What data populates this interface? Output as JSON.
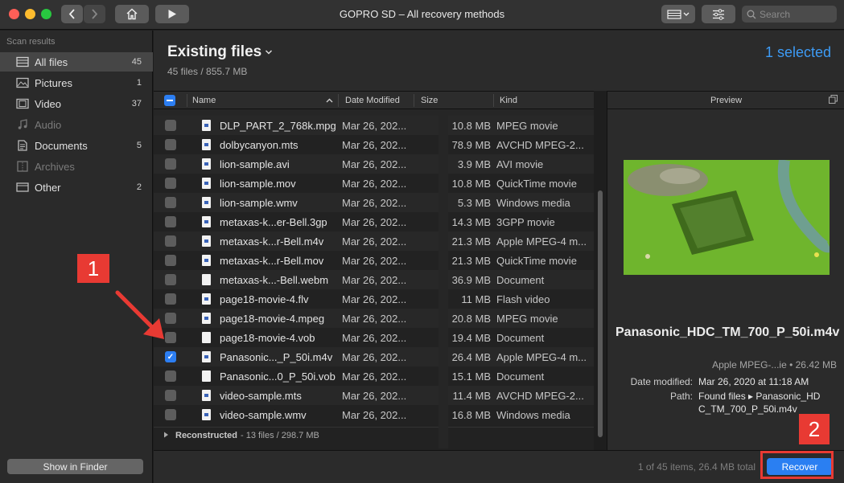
{
  "window": {
    "title": "GOPRO SD – All recovery methods"
  },
  "toolbar": {
    "search_placeholder": "Search"
  },
  "sidebar": {
    "heading": "Scan results",
    "items": [
      {
        "label": "All files",
        "count": "45",
        "icon": "stack-icon",
        "active": true
      },
      {
        "label": "Pictures",
        "count": "1",
        "icon": "picture-icon"
      },
      {
        "label": "Video",
        "count": "37",
        "icon": "film-icon"
      },
      {
        "label": "Audio",
        "count": "",
        "icon": "music-note-icon",
        "dim": true
      },
      {
        "label": "Documents",
        "count": "5",
        "icon": "document-icon"
      },
      {
        "label": "Archives",
        "count": "",
        "icon": "archive-icon",
        "dim": true
      },
      {
        "label": "Other",
        "count": "2",
        "icon": "other-icon"
      }
    ],
    "finder_button": "Show in Finder"
  },
  "main": {
    "title": "Existing files",
    "subtitle": "45 files / 855.7 MB",
    "selected": "1 selected"
  },
  "table": {
    "columns": {
      "name": "Name",
      "date": "Date Modified",
      "size": "Size",
      "kind": "Kind"
    },
    "rows": [
      {
        "name": "DLP_PART_2_768k.mpg",
        "date": "Mar 26, 202...",
        "size": "10.8 MB",
        "kind": "MPEG movie",
        "checked": false,
        "video": true
      },
      {
        "name": "dolbycanyon.mts",
        "date": "Mar 26, 202...",
        "size": "78.9 MB",
        "kind": "AVCHD MPEG-2...",
        "checked": false,
        "video": true
      },
      {
        "name": "lion-sample.avi",
        "date": "Mar 26, 202...",
        "size": "3.9 MB",
        "kind": "AVI movie",
        "checked": false,
        "video": true
      },
      {
        "name": "lion-sample.mov",
        "date": "Mar 26, 202...",
        "size": "10.8 MB",
        "kind": "QuickTime movie",
        "checked": false,
        "video": true
      },
      {
        "name": "lion-sample.wmv",
        "date": "Mar 26, 202...",
        "size": "5.3 MB",
        "kind": "Windows media",
        "checked": false,
        "video": true
      },
      {
        "name": "metaxas-k...er-Bell.3gp",
        "date": "Mar 26, 202...",
        "size": "14.3 MB",
        "kind": "3GPP movie",
        "checked": false,
        "video": true
      },
      {
        "name": "metaxas-k...r-Bell.m4v",
        "date": "Mar 26, 202...",
        "size": "21.3 MB",
        "kind": "Apple MPEG-4 m...",
        "checked": false,
        "video": true
      },
      {
        "name": "metaxas-k...r-Bell.mov",
        "date": "Mar 26, 202...",
        "size": "21.3 MB",
        "kind": "QuickTime movie",
        "checked": false,
        "video": true
      },
      {
        "name": "metaxas-k...-Bell.webm",
        "date": "Mar 26, 202...",
        "size": "36.9 MB",
        "kind": "Document",
        "checked": false,
        "video": false
      },
      {
        "name": "page18-movie-4.flv",
        "date": "Mar 26, 202...",
        "size": "11 MB",
        "kind": "Flash video",
        "checked": false,
        "video": true
      },
      {
        "name": "page18-movie-4.mpeg",
        "date": "Mar 26, 202...",
        "size": "20.8 MB",
        "kind": "MPEG movie",
        "checked": false,
        "video": true
      },
      {
        "name": "page18-movie-4.vob",
        "date": "Mar 26, 202...",
        "size": "19.4 MB",
        "kind": "Document",
        "checked": false,
        "video": false
      },
      {
        "name": "Panasonic..._P_50i.m4v",
        "date": "Mar 26, 202...",
        "size": "26.4 MB",
        "kind": "Apple MPEG-4 m...",
        "checked": true,
        "video": true
      },
      {
        "name": "Panasonic...0_P_50i.vob",
        "date": "Mar 26, 202...",
        "size": "15.1 MB",
        "kind": "Document",
        "checked": false,
        "video": false
      },
      {
        "name": "video-sample.mts",
        "date": "Mar 26, 202...",
        "size": "11.4 MB",
        "kind": "AVCHD MPEG-2...",
        "checked": false,
        "video": true
      },
      {
        "name": "video-sample.wmv",
        "date": "Mar 26, 202...",
        "size": "16.8 MB",
        "kind": "Windows media",
        "checked": false,
        "video": true
      }
    ],
    "reconstructed": {
      "label": "Reconstructed",
      "detail": "- 13 files / 298.7 MB"
    }
  },
  "preview": {
    "heading": "Preview",
    "file_name": "Panasonic_HDC_TM_700_P_50i.m4v",
    "kind_size": "Apple MPEG-...ie • 26.42 MB",
    "date_label": "Date modified:",
    "date_value": "Mar 26, 2020 at 11:18 AM",
    "path_label": "Path:",
    "path_line1": "Found files ▸ Panasonic_HD",
    "path_line2": "C_TM_700_P_50i.m4v"
  },
  "status": {
    "text": "1 of 45 items, 26.4 MB total",
    "recover_label": "Recover"
  },
  "annotations": {
    "step1": "1",
    "step2": "2"
  },
  "colors": {
    "accent": "#2a7ff2",
    "annotation": "#e83a33",
    "selected_text": "#3d9bf5"
  }
}
